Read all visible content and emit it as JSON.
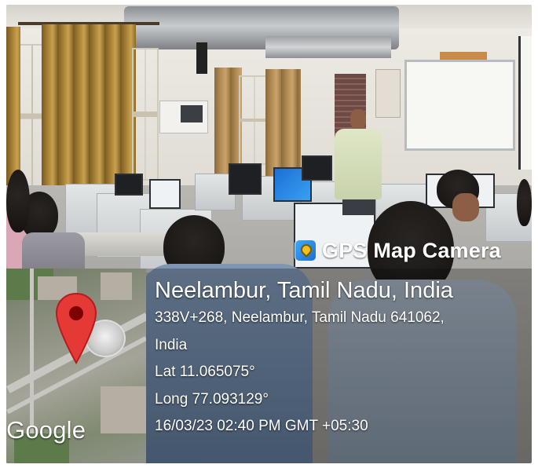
{
  "overlay": {
    "app_name": "GPS Map Camera",
    "app_icon": "map-pin-camera-icon",
    "location_title": "Neelambur, Tamil Nadu, India",
    "address_line1": "338V+268, Neelambur, Tamil Nadu 641062,",
    "address_line2": "India",
    "latitude": "Lat 11.065075°",
    "longitude": "Long 77.093129°",
    "datetime": "16/03/23 02:40 PM GMT +05:30"
  },
  "map": {
    "provider_label": "Google",
    "pin_icon": "location-pin-icon",
    "pin_color": "#e53935"
  },
  "scene": {
    "type": "computer-lab-photo"
  }
}
